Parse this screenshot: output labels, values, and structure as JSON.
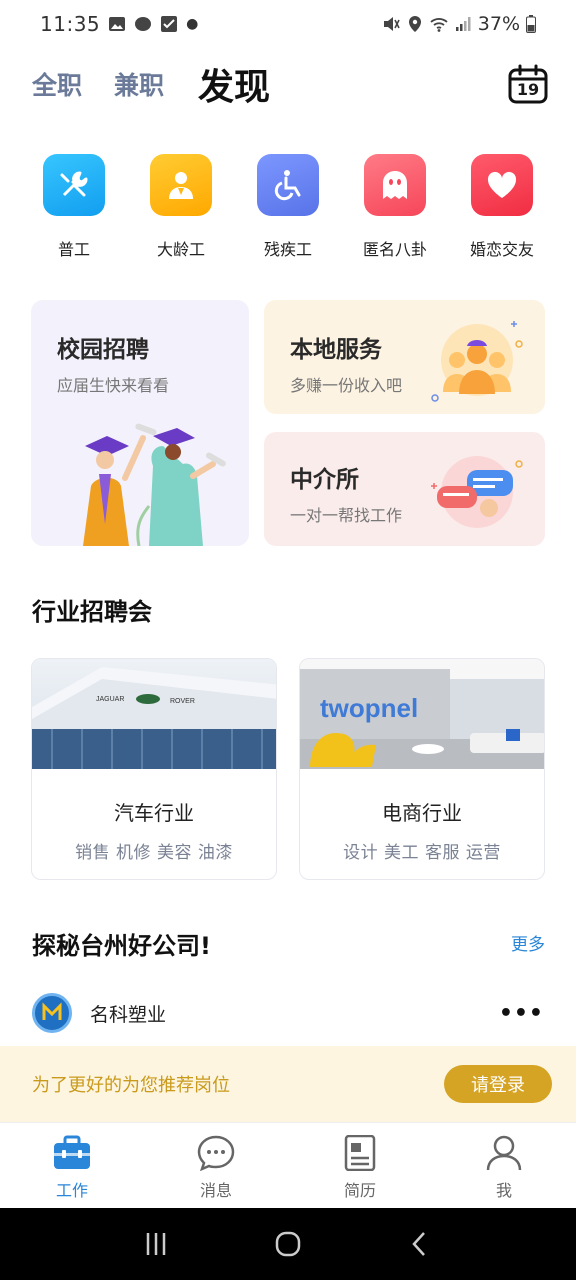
{
  "status_bar": {
    "time": "11:35",
    "battery": "37%"
  },
  "header": {
    "tabs": [
      {
        "label": "全职",
        "active": false
      },
      {
        "label": "兼职",
        "active": false
      },
      {
        "label": "发现",
        "active": true
      }
    ],
    "calendar_day": "19"
  },
  "quick_categories": [
    {
      "label": "普工",
      "icon": "tools-icon",
      "color": "#1fb3f5"
    },
    {
      "label": "大龄工",
      "icon": "worker-icon",
      "color": "#ffb814"
    },
    {
      "label": "残疾工",
      "icon": "wheelchair-icon",
      "color": "#6b86f2"
    },
    {
      "label": "匿名八卦",
      "icon": "ghost-icon",
      "color": "#fb5a6a"
    },
    {
      "label": "婚恋交友",
      "icon": "heart-icon",
      "color": "#fb3b4d"
    }
  ],
  "features": {
    "campus": {
      "title": "校园招聘",
      "subtitle": "应届生快来看看"
    },
    "local": {
      "title": "本地服务",
      "subtitle": "多赚一份收入吧"
    },
    "agency": {
      "title": "中介所",
      "subtitle": "一对一帮找工作"
    }
  },
  "industry_section": {
    "title": "行业招聘会",
    "cards": [
      {
        "title": "汽车行业",
        "tags": "销售 机修 美容 油漆"
      },
      {
        "title": "电商行业",
        "tags": "设计 美工 客服 运营"
      }
    ]
  },
  "company_section": {
    "title": "探秘台州好公司!",
    "more": "更多",
    "companies": [
      {
        "name": "名科塑业"
      }
    ]
  },
  "login_banner": {
    "text": "为了更好的为您推荐岗位",
    "button": "请登录"
  },
  "bottom_nav": [
    {
      "label": "工作",
      "icon": "briefcase-icon",
      "active": true
    },
    {
      "label": "消息",
      "icon": "chat-icon",
      "active": false
    },
    {
      "label": "简历",
      "icon": "resume-icon",
      "active": false
    },
    {
      "label": "我",
      "icon": "user-icon",
      "active": false
    }
  ],
  "colors": {
    "accent": "#2a86d8",
    "login_button": "#d6a424"
  }
}
